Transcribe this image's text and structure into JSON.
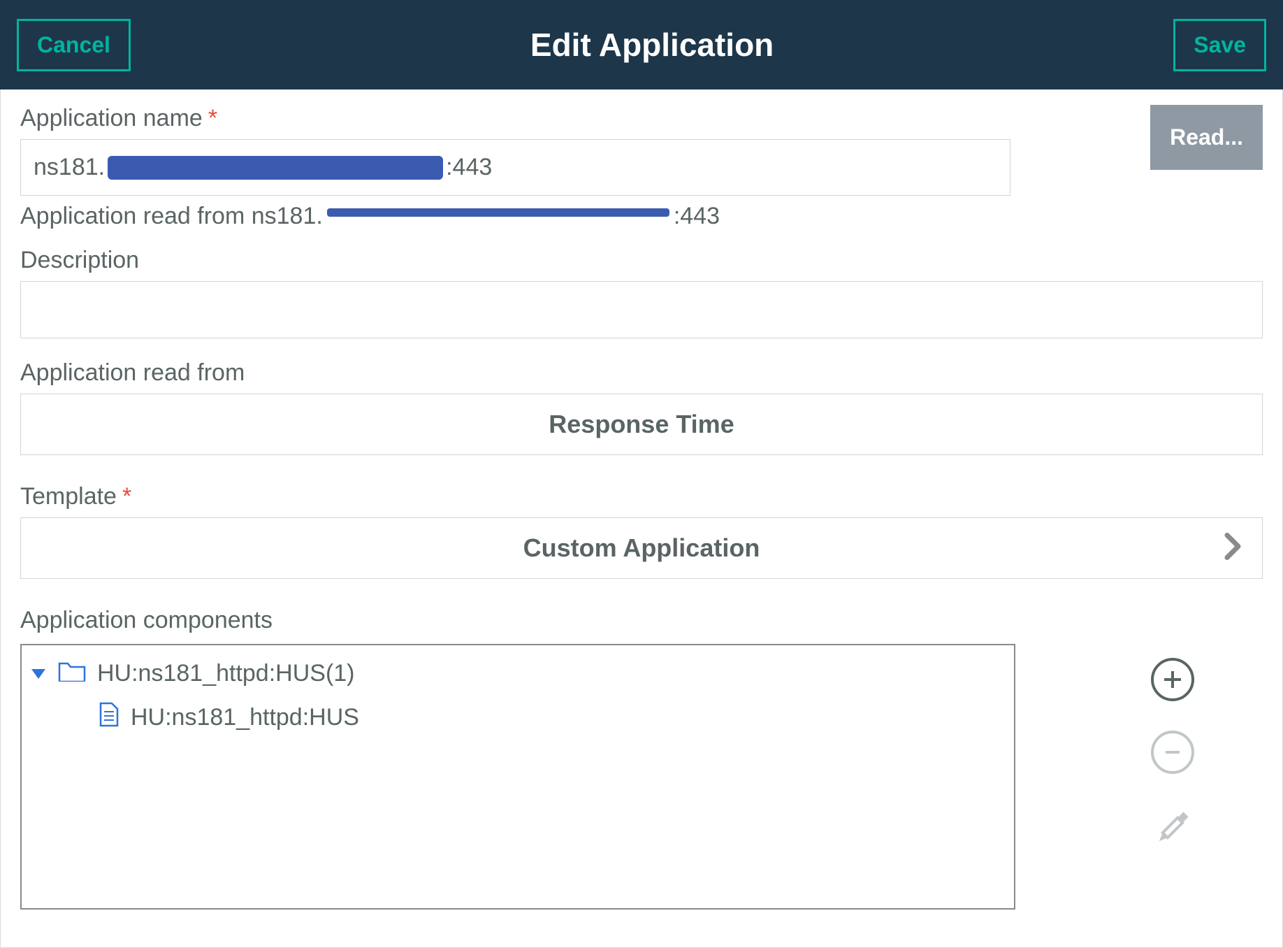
{
  "header": {
    "title": "Edit Application",
    "cancel_label": "Cancel",
    "save_label": "Save"
  },
  "form": {
    "appname_label": "Application name",
    "appname_prefix": "ns181.",
    "appname_suffix": ":443",
    "read_button": "Read...",
    "readfrom_prefix": "Application read from ns181.",
    "readfrom_suffix": ":443",
    "description_label": "Description",
    "description_value": "",
    "readfrom_label": "Application read from",
    "readfrom_select": "Response Time",
    "template_label": "Template",
    "template_value": "Custom Application",
    "components_label": "Application components"
  },
  "tree": {
    "folder": "HU:ns181_httpd:HUS(1)",
    "leaf": "HU:ns181_httpd:HUS"
  },
  "icons": {
    "folder": "folder-icon",
    "file": "file-icon",
    "add": "plus-icon",
    "remove": "minus-icon",
    "edit": "pencil-icon",
    "caret": "chevron-right-icon",
    "expand": "caret-down-icon"
  }
}
